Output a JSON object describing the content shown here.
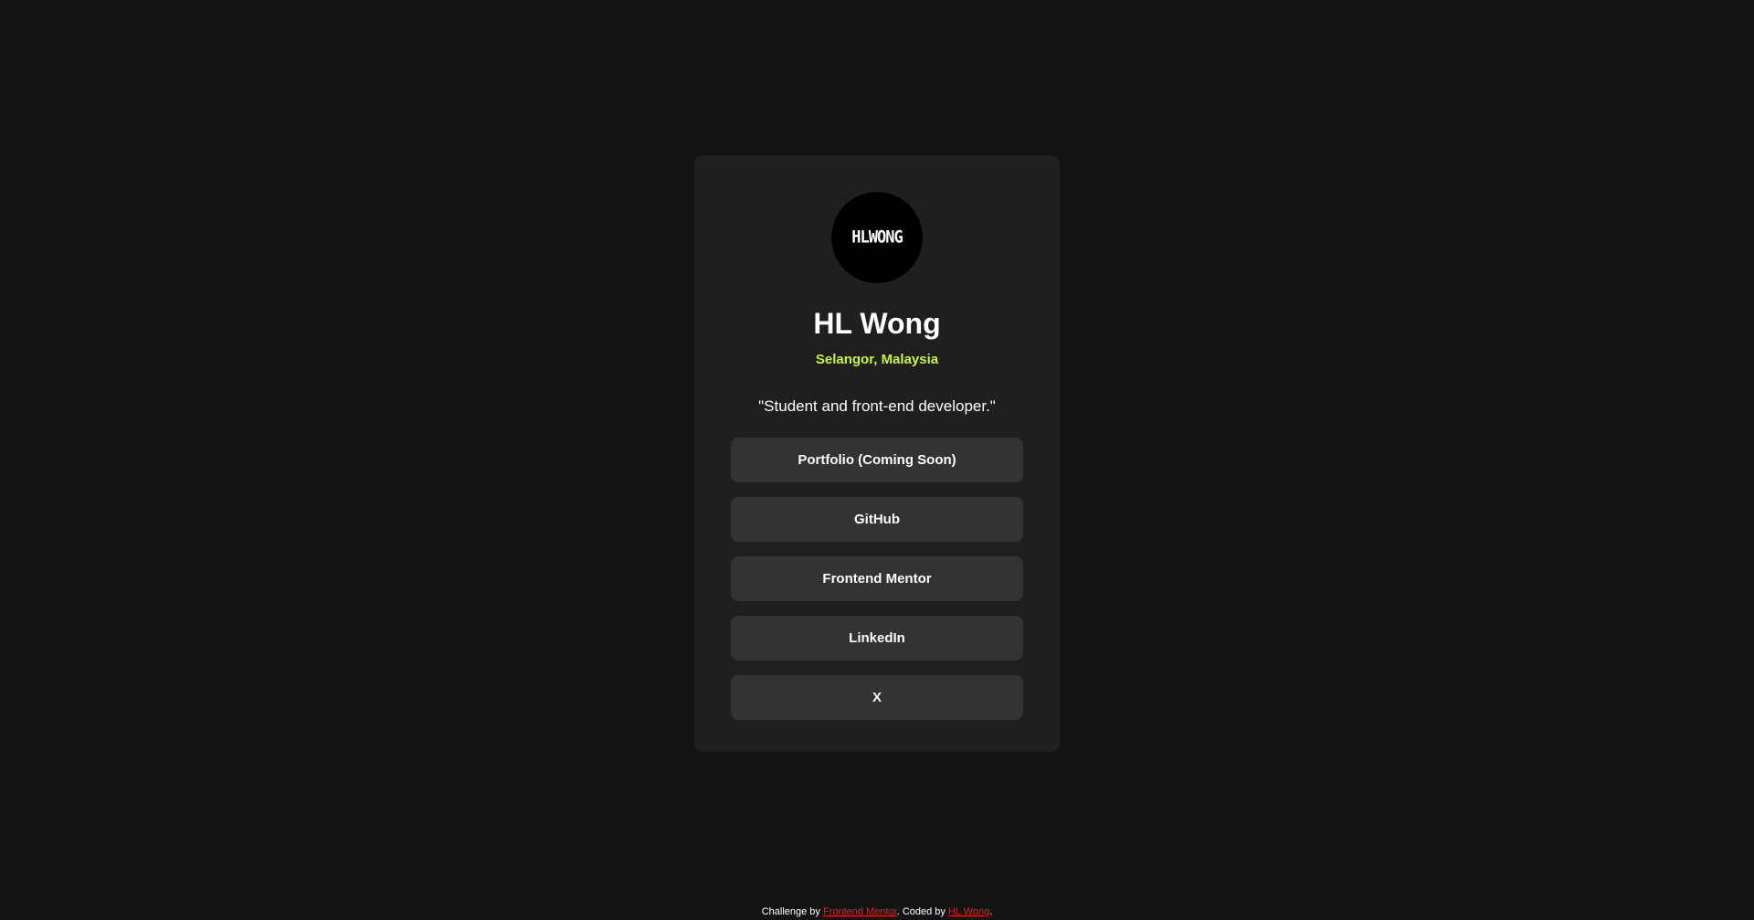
{
  "profile": {
    "avatar_text": "HLWONG",
    "name": "HL Wong",
    "location": "Selangor, Malaysia",
    "bio": "\"Student and front-end developer.\""
  },
  "links": [
    {
      "label": "Portfolio (Coming Soon)"
    },
    {
      "label": "GitHub"
    },
    {
      "label": "Frontend Mentor"
    },
    {
      "label": "LinkedIn"
    },
    {
      "label": "X"
    }
  ],
  "footer": {
    "prefix": "Challenge by ",
    "challenge_link": "Frontend Mentor",
    "middle": ". Coded by ",
    "author_link": "HL Wong",
    "suffix": "."
  },
  "colors": {
    "background": "#141414",
    "card": "#1f1f1f",
    "button": "#333333",
    "accent": "#c4f82a",
    "footer_link": "#e02020"
  }
}
